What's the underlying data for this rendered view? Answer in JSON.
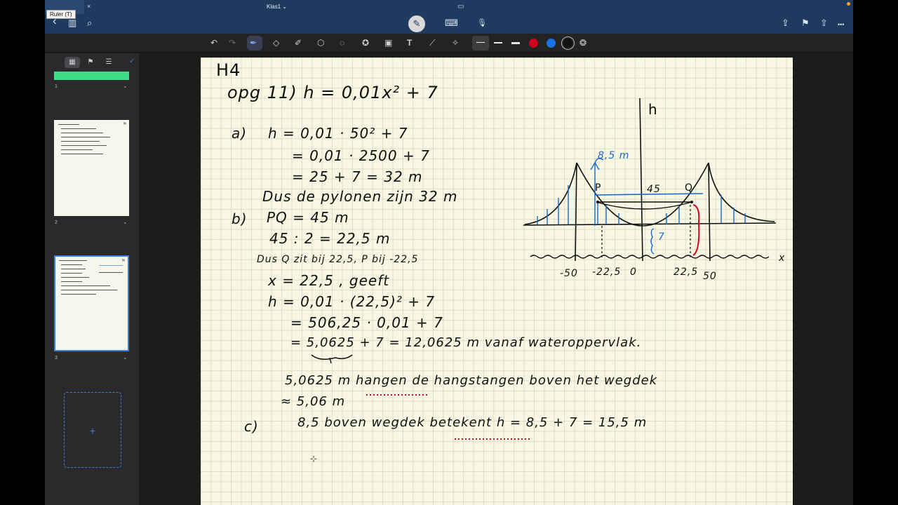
{
  "app": {
    "tooltip": "Ruler (T)",
    "tab_close": "×",
    "document_title": "Klas1 ⌄"
  },
  "nav": {
    "back": "‹",
    "sidebar": "▥",
    "search": "⌕",
    "pen": "✎",
    "keyboard": "⌨",
    "mic": "🎙",
    "export": "⇪",
    "bookmark": "⚑",
    "share": "⇧",
    "more": "•••"
  },
  "toolbar": {
    "undo": "↶",
    "redo": "↷",
    "pen": "✒",
    "eraser": "◇",
    "highlighter": "✐",
    "shapes": "⬡",
    "lasso": "◌",
    "sticker": "✪",
    "image": "▣",
    "text": "T",
    "ruler": "⟋",
    "laser": "✧",
    "colors": [
      "#d0021b",
      "#1a73e8",
      "#111111"
    ],
    "color_wheel": "❂"
  },
  "sidebar": {
    "tab_icons": [
      "▦",
      "⚑",
      "☰"
    ],
    "check": "✓",
    "pages": [
      {
        "number": "1",
        "chevron": "⌄"
      },
      {
        "number": "2",
        "chevron": "⌄"
      },
      {
        "number": "3",
        "chevron": "⌄"
      }
    ],
    "add_page": "+"
  },
  "notes": {
    "header": "H4",
    "problem": "opg 11)   h = 0,01x² + 7",
    "a_label": "a)",
    "a1": "h = 0,01 · 50² + 7",
    "a2": "= 0,01 · 2500 + 7",
    "a3": "=  25 + 7  = 32 m",
    "a4": "Dus de pylonen zijn 32 m",
    "b_label": "b)",
    "b1": "PQ = 45 m",
    "b2": "45 : 2 = 22,5 m",
    "b3": "Dus Q zit bij 22,5,  P bij -22,5",
    "b4": "x = 22,5 , geeft",
    "b5": "h = 0,01 · (22,5)² + 7",
    "b6": "= 506,25 · 0,01 + 7",
    "b7": "= 5,0625 + 7    = 12,0625 m vanaf wateroppervlak.",
    "b8": "5,0625 m  hangen de hangstangen boven het wegdek",
    "b9": "≈ 5,06 m",
    "c_label": "c)",
    "c1": "8,5 boven wegdek  betekent   h = 8,5 + 7 = 15,5 m"
  },
  "sketch": {
    "h_axis": "h",
    "x_axis": "x",
    "label_85": "8,5 m",
    "label_P": "P",
    "label_Q": "Q",
    "label_45": "45",
    "label_7": "7",
    "ticks": [
      "-50",
      "-22,5",
      "0",
      "22,5",
      "50"
    ]
  }
}
